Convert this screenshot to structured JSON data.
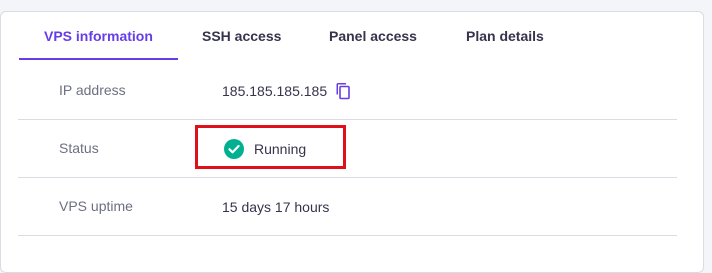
{
  "tabs": [
    {
      "label": "VPS information",
      "active": true
    },
    {
      "label": "SSH access",
      "active": false
    },
    {
      "label": "Panel access",
      "active": false
    },
    {
      "label": "Plan details",
      "active": false
    }
  ],
  "rows": [
    {
      "label": "IP address",
      "value": "185.185.185.185",
      "icon": "copy-icon"
    },
    {
      "label": "Status",
      "value": "Running",
      "icon": "check-circle-icon"
    },
    {
      "label": "VPS uptime",
      "value": "15 days 17 hours"
    }
  ],
  "colors": {
    "accent": "#673de6",
    "success": "#00b090",
    "highlight": "#e0101a"
  }
}
